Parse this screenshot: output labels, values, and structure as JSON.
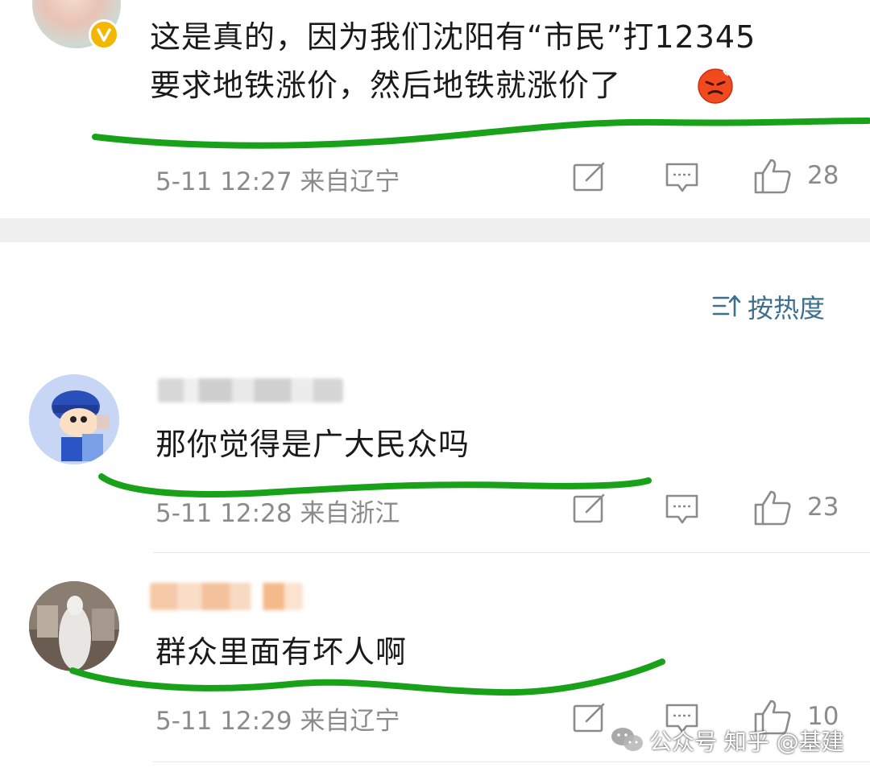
{
  "comments": [
    {
      "text_line1": "这是真的，因为我们沈阳有“市民”打12345",
      "text_line2": "要求地铁涨价，然后地铁就涨价了",
      "emoji": "angry-face",
      "meta": "5-11 12:27 来自辽宁",
      "likes": "28"
    },
    {
      "text": "那你觉得是广大民众吗",
      "meta": "5-11 12:28 来自浙江",
      "likes": "23"
    },
    {
      "text": "群众里面有坏人啊",
      "meta": "5-11 12:29 来自辽宁",
      "likes": "10"
    }
  ],
  "sort": {
    "label": "按热度",
    "icon": "sort-icon"
  },
  "watermark": "公众号 知乎 @基建",
  "colors": {
    "accent": "#3d6f8f",
    "highlight": "#1aa11a",
    "text": "#1a1a1a",
    "meta": "#8b8b8b"
  }
}
